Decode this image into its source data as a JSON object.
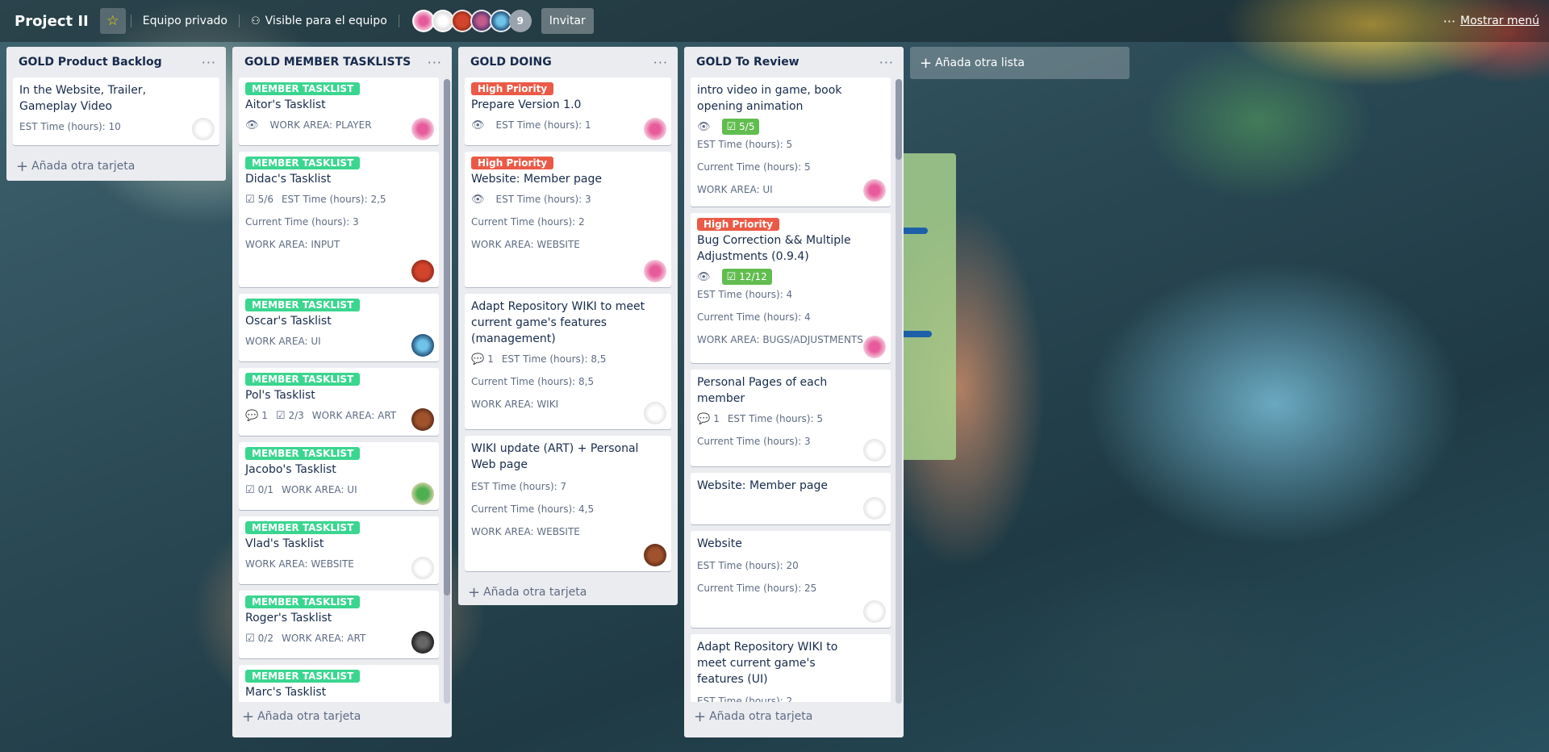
{
  "header": {
    "board_title": "Project II",
    "team": "Equipo privado",
    "visibility": "Visible para el equipo",
    "member_count": "9",
    "invite": "Invitar",
    "show_menu": "Mostrar menú"
  },
  "lists": [
    {
      "title": "GOLD Product Backlog",
      "add_card": "Añada otra tarjeta",
      "cards": [
        {
          "title": "In the Website, Trailer, Gameplay Video",
          "est": "EST Time (hours): 10"
        }
      ]
    },
    {
      "title": "GOLD MEMBER TASKLISTS",
      "add_card": "Añada otra tarjeta",
      "cards": [
        {
          "label": "MEMBER TASKLIST",
          "title": "Aitor's Tasklist",
          "work": "WORK AREA: PLAYER"
        },
        {
          "label": "MEMBER TASKLIST",
          "title": "Didac's Tasklist",
          "checklist": "5/6",
          "est": "EST Time (hours): 2,5",
          "current": "Current Time (hours): 3",
          "work": "WORK AREA: INPUT"
        },
        {
          "label": "MEMBER TASKLIST",
          "title": "Oscar's Tasklist",
          "work": "WORK AREA: UI"
        },
        {
          "label": "MEMBER TASKLIST",
          "title": "Pol's Tasklist",
          "comments": "1",
          "checklist": "2/3",
          "work": "WORK AREA: ART"
        },
        {
          "label": "MEMBER TASKLIST",
          "title": "Jacobo's Tasklist",
          "checklist": "0/1",
          "work": "WORK AREA: UI"
        },
        {
          "label": "MEMBER TASKLIST",
          "title": "Vlad's Tasklist",
          "work": "WORK AREA: WEBSITE"
        },
        {
          "label": "MEMBER TASKLIST",
          "title": "Roger's Tasklist",
          "checklist": "0/2",
          "work": "WORK AREA: ART"
        },
        {
          "label": "MEMBER TASKLIST",
          "title": "Marc's Tasklist"
        }
      ]
    },
    {
      "title": "GOLD DOING",
      "add_card": "Añada otra tarjeta",
      "cards": [
        {
          "label": "High Priority",
          "title": "Prepare Version 1.0",
          "est": "EST Time (hours): 1"
        },
        {
          "label": "High Priority",
          "title": "Website: Member page",
          "est": "EST Time (hours): 3",
          "current": "Current Time (hours): 2",
          "work": "WORK AREA: WEBSITE"
        },
        {
          "title": "Adapt Repository WIKI to meet current game's features (management)",
          "comments": "1",
          "est": "EST Time (hours): 8,5",
          "current": "Current Time (hours): 8,5",
          "work": "WORK AREA: WIKI"
        },
        {
          "title": "WIKI update (ART) + Personal Web page",
          "est": "EST Time (hours): 7",
          "current": "Current Time (hours): 4,5",
          "work": "WORK AREA: WEBSITE"
        }
      ]
    },
    {
      "title": "GOLD To Review",
      "add_card": "Añada otra tarjeta",
      "cards": [
        {
          "title": "intro video in game, book opening animation",
          "checklist": "5/5",
          "est": "EST Time (hours): 5",
          "current": "Current Time (hours): 5",
          "work": "WORK AREA: UI"
        },
        {
          "label": "High Priority",
          "title": "Bug Correction && Multiple Adjustments (0.9.4)",
          "checklist": "12/12",
          "est": "EST Time (hours): 4",
          "current": "Current Time (hours): 4",
          "work": "WORK AREA: BUGS/ADJUSTMENTS"
        },
        {
          "title": "Personal Pages of each member",
          "comments": "1",
          "est": "EST Time (hours): 5",
          "current": "Current Time (hours): 3"
        },
        {
          "title": "Website: Member page"
        },
        {
          "title": "Website",
          "est": "EST Time (hours): 20",
          "current": "Current Time (hours): 25"
        },
        {
          "title": "Adapt Repository WIKI to meet current game's features (UI)",
          "est": "EST Time (hours): 2"
        }
      ]
    }
  ],
  "add_list": "Añada otra lista",
  "colors": {
    "member_label": "#3ad68f",
    "priority_label": "#eb5a46",
    "checklist_done": "#61bd4f"
  }
}
